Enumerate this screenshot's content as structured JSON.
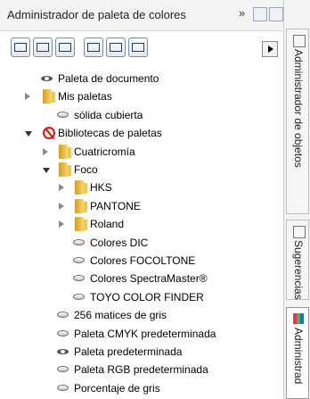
{
  "panel": {
    "title": "Administrador de paleta de colores",
    "chevron": "»"
  },
  "tree": [
    {
      "label": "Paleta de documento",
      "icon": "eye-icon",
      "level": 0,
      "expander": "none"
    },
    {
      "label": "Mis paletas",
      "icon": "folder-icon",
      "level": 0,
      "expander": "collapsed"
    },
    {
      "label": "sólida cubierta",
      "icon": "palette-icon",
      "level": 1,
      "expander": "none"
    },
    {
      "label": "Bibliotecas de paletas",
      "icon": "library-icon",
      "level": 0,
      "expander": "expanded"
    },
    {
      "label": "Cuatricromía",
      "icon": "folder-icon",
      "level": 1,
      "expander": "collapsed"
    },
    {
      "label": "Foco",
      "icon": "folder-icon",
      "level": 1,
      "expander": "expanded"
    },
    {
      "label": "HKS",
      "icon": "folder-icon",
      "level": 2,
      "expander": "collapsed"
    },
    {
      "label": "PANTONE",
      "icon": "folder-icon",
      "level": 2,
      "expander": "collapsed"
    },
    {
      "label": "Roland",
      "icon": "folder-icon",
      "level": 2,
      "expander": "collapsed"
    },
    {
      "label": "Colores DIC",
      "icon": "palette-icon",
      "level": 2,
      "expander": "none"
    },
    {
      "label": "Colores FOCOLTONE",
      "icon": "palette-icon",
      "level": 2,
      "expander": "none"
    },
    {
      "label": "Colores SpectraMaster®",
      "icon": "palette-icon",
      "level": 2,
      "expander": "none"
    },
    {
      "label": "TOYO COLOR FINDER",
      "icon": "palette-icon",
      "level": 2,
      "expander": "none"
    },
    {
      "label": "256 matices de gris",
      "icon": "palette-icon",
      "level": 1,
      "expander": "none"
    },
    {
      "label": "Paleta CMYK predeterminada",
      "icon": "palette-icon",
      "level": 1,
      "expander": "none"
    },
    {
      "label": "Paleta predeterminada",
      "icon": "eye-icon",
      "level": 1,
      "expander": "none"
    },
    {
      "label": "Paleta RGB predeterminada",
      "icon": "palette-icon",
      "level": 1,
      "expander": "none"
    },
    {
      "label": "Porcentaje de gris",
      "icon": "palette-icon",
      "level": 1,
      "expander": "none"
    }
  ],
  "side_tabs": [
    {
      "label": "Administrador de objetos",
      "icon": "object-manager-icon"
    },
    {
      "label": "Sugerencias",
      "icon": "hints-icon"
    },
    {
      "label": "Administrad",
      "icon": "color-palette-manager-icon"
    }
  ]
}
